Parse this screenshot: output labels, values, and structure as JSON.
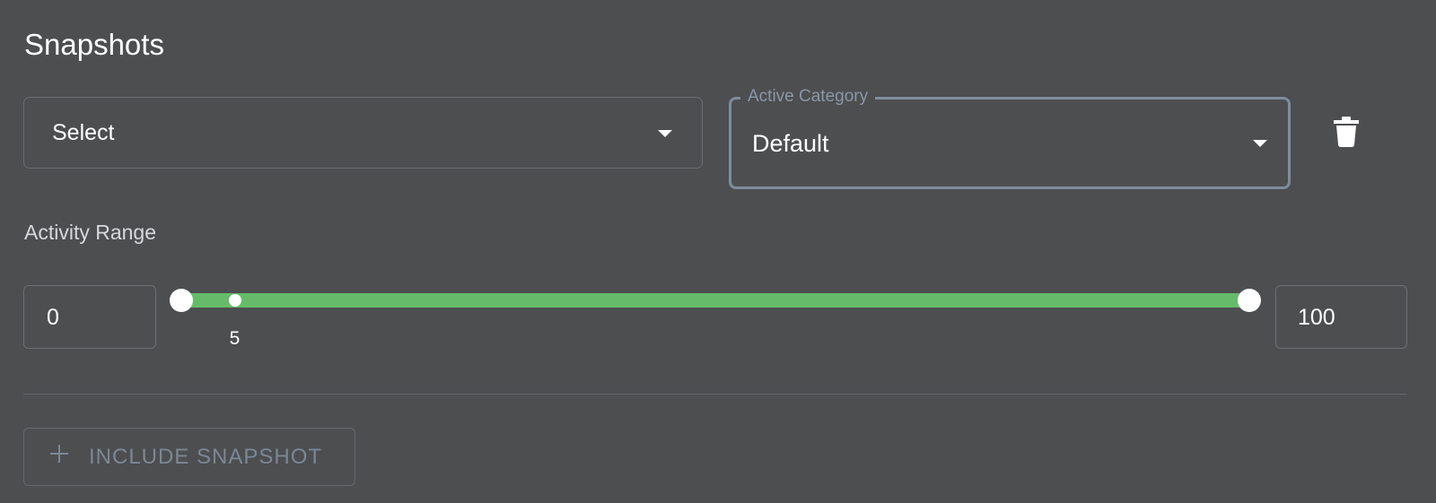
{
  "header": {
    "title": "Snapshots"
  },
  "snapshot_select": {
    "value": "Select"
  },
  "category_select": {
    "label": "Active Category",
    "value": "Default"
  },
  "delete_button": {
    "icon": "trash-icon"
  },
  "activity_range": {
    "label": "Activity Range",
    "min_value": "0",
    "max_value": "100",
    "range_min": 0,
    "range_max": 100,
    "selected_low": 0,
    "selected_high": 100,
    "mark_value": 5,
    "mark_label": "5",
    "track_color": "#66bb6a"
  },
  "include_snapshot_button": {
    "icon": "plus-icon",
    "label": "INCLUDE SNAPSHOT"
  },
  "colors": {
    "background": "#4d4e50",
    "accent_outline": "#7f8c9c",
    "slider_green": "#66bb6a",
    "disabled_text": "#7b8796"
  }
}
